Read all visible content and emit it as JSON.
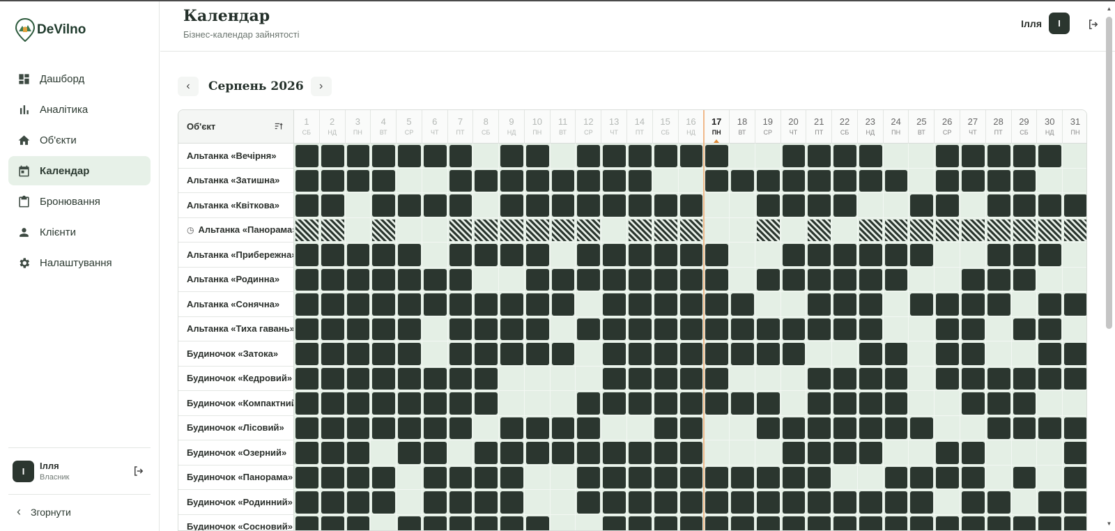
{
  "brand": {
    "name": "DeVilno"
  },
  "header": {
    "title": "Календар",
    "subtitle": "Бізнес-календар зайнятості",
    "user_name": "Ілля",
    "user_initial": "І"
  },
  "sidebar": {
    "items": [
      {
        "label": "Дашборд",
        "icon": "dashboard-icon",
        "active": false
      },
      {
        "label": "Аналітика",
        "icon": "analytics-icon",
        "active": false
      },
      {
        "label": "Об'єкти",
        "icon": "home-icon",
        "active": false
      },
      {
        "label": "Календар",
        "icon": "calendar-icon",
        "active": true
      },
      {
        "label": "Бронювання",
        "icon": "clipboard-icon",
        "active": false
      },
      {
        "label": "Клієнти",
        "icon": "person-icon",
        "active": false
      },
      {
        "label": "Налаштування",
        "icon": "gear-icon",
        "active": false
      }
    ],
    "user": {
      "name": "Ілля",
      "role": "Власник",
      "initial": "І"
    },
    "collapse_label": "Згорнути"
  },
  "calendar": {
    "month_label": "Серпень 2026",
    "prev_label": "‹",
    "next_label": "›",
    "object_header": "Об'єкт",
    "today": 17,
    "days": [
      {
        "d": "1",
        "w": "СБ"
      },
      {
        "d": "2",
        "w": "НД"
      },
      {
        "d": "3",
        "w": "ПН"
      },
      {
        "d": "4",
        "w": "ВТ"
      },
      {
        "d": "5",
        "w": "СР"
      },
      {
        "d": "6",
        "w": "ЧТ"
      },
      {
        "d": "7",
        "w": "ПТ"
      },
      {
        "d": "8",
        "w": "СБ"
      },
      {
        "d": "9",
        "w": "НД"
      },
      {
        "d": "10",
        "w": "ПН"
      },
      {
        "d": "11",
        "w": "ВТ"
      },
      {
        "d": "12",
        "w": "СР"
      },
      {
        "d": "13",
        "w": "ЧТ"
      },
      {
        "d": "14",
        "w": "ПТ"
      },
      {
        "d": "15",
        "w": "СБ"
      },
      {
        "d": "16",
        "w": "НД"
      },
      {
        "d": "17",
        "w": "ПН"
      },
      {
        "d": "18",
        "w": "ВТ"
      },
      {
        "d": "19",
        "w": "СР"
      },
      {
        "d": "20",
        "w": "ЧТ"
      },
      {
        "d": "21",
        "w": "ПТ"
      },
      {
        "d": "22",
        "w": "СБ"
      },
      {
        "d": "23",
        "w": "НД"
      },
      {
        "d": "24",
        "w": "ПН"
      },
      {
        "d": "25",
        "w": "ВТ"
      },
      {
        "d": "26",
        "w": "СР"
      },
      {
        "d": "27",
        "w": "ЧТ"
      },
      {
        "d": "28",
        "w": "ПТ"
      },
      {
        "d": "29",
        "w": "СБ"
      },
      {
        "d": "30",
        "w": "НД"
      },
      {
        "d": "31",
        "w": "ПН"
      }
    ],
    "rows": [
      {
        "name": "Альтанка «Вечірня»",
        "clock": false,
        "cells": "BBBBBBB.BB.BBBBBB..BBBB..BBBBB..."
      },
      {
        "name": "Альтанка «Затишна»",
        "clock": false,
        "cells": "BBBB..BBBBBBBB..BBBBBBBB.BBBB..."
      },
      {
        "name": "Альтанка «Квіткова»",
        "clock": false,
        "cells": "BB.BBBB.BBBBBBBB..BBBB..BB.BBBBB"
      },
      {
        "name": "Альтанка «Панорама»",
        "clock": true,
        "cells": "HH.H..HHHHHH.HHH..H.H.HHHHHHHHHH"
      },
      {
        "name": "Альтанка «Прибережна»",
        "clock": false,
        "cells": "BBBBB.BBBB.BBBBBB..BBBBBB..BBB.."
      },
      {
        "name": "Альтанка «Родинна»",
        "clock": false,
        "cells": "BBBBBBB..BBBBBBBB.BBBBBB..BBB..."
      },
      {
        "name": "Альтанка «Сонячна»",
        "clock": false,
        "cells": "BBBBBBBBBBB.BBBBBB..BBB.BBBB.BB."
      },
      {
        "name": "Альтанка «Тиха гавань»",
        "clock": false,
        "cells": "BBBBB.BBBB.BBBBBBBBBBBB..BB.BB..."
      },
      {
        "name": "Будиночок «Затока»",
        "clock": false,
        "cells": "BBBBB.BBBBB.BBBBBBBB..BB.BB..BB."
      },
      {
        "name": "Будиночок «Кедровий»",
        "clock": false,
        "cells": "BBBBBBBB....BBBBB...BBBB.BBBBBBBB"
      },
      {
        "name": "Будиночок «Компактний»",
        "clock": false,
        "cells": "BBBBBBBB...BBBBBBBB.BBBB..BBB..B"
      },
      {
        "name": "Будиночок «Лісовий»",
        "clock": false,
        "cells": "BBBBBBB.BBBB..BB..BBBBBBB..BBBB."
      },
      {
        "name": "Будиночок «Озерний»",
        "clock": false,
        "cells": "BBB.BB.BBBBBBBBB...BBBB..BB...BBB"
      },
      {
        "name": "Будиночок «Панорама»",
        "clock": false,
        "cells": "BBBB.BBBB..BBBBBBBBBB..BBBB.B.BBB"
      },
      {
        "name": "Будиночок «Родинний»",
        "clock": false,
        "cells": "BBBB.BBBB..BBBBBBBBBBBBBB.BB.BBBB"
      },
      {
        "name": "Будиночок «Сосновий»",
        "clock": false,
        "cells": "BBB.BBBBBB..BBBBBBBBBBBBBBBBBBBB"
      }
    ]
  },
  "colors": {
    "booked": "#2b362f",
    "free": "#e4efe5",
    "accent_today": "#e08a36",
    "active_nav": "#e7f1e8"
  }
}
